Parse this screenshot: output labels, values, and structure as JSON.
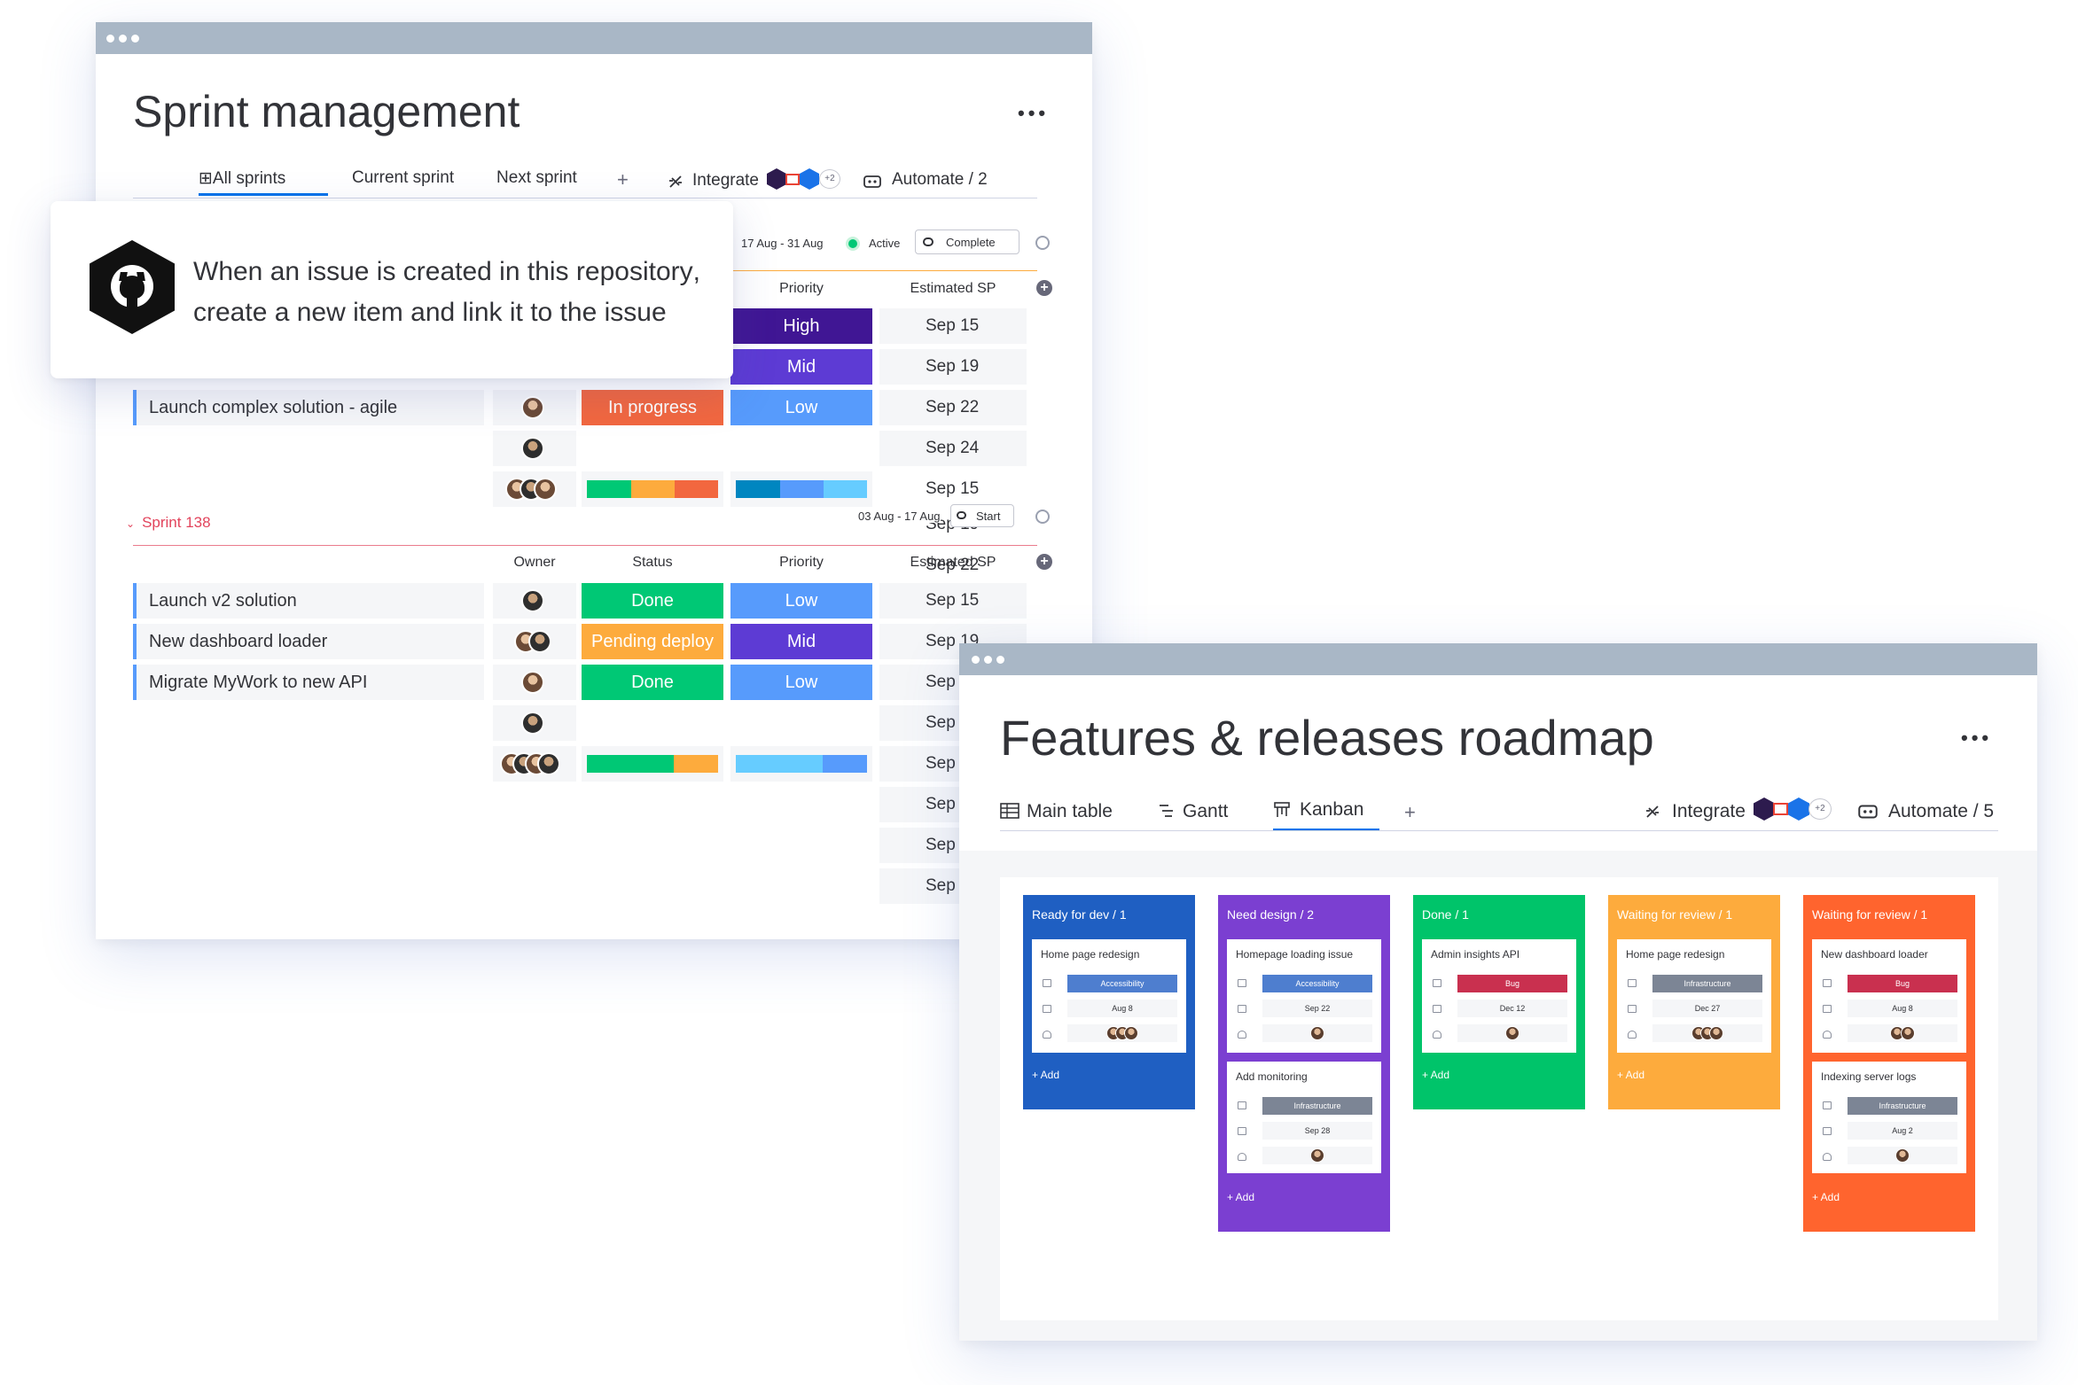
{
  "sprint": {
    "title": "Sprint management",
    "more": "•••",
    "tabs": [
      "⊞All sprints",
      "Current sprint",
      "Next sprint"
    ],
    "tab_plus": "+",
    "integrate_label": "Integrate",
    "integrate_badge": "+2",
    "automate_label": "Automate / 2",
    "group1": {
      "date_range": "17 Aug - 31 Aug",
      "state": "Active",
      "action": "Complete",
      "columns": {
        "priority": "Priority",
        "sp": "Estimated SP"
      },
      "priorities": [
        "High",
        "Mid",
        "Low"
      ],
      "row_name": "Launch complex solution - agile",
      "row_status": "In progress",
      "sp_values": [
        "Sep 15",
        "Sep 19",
        "Sep 22",
        "Sep 24",
        "Sep 15",
        "Sep 19",
        "Sep 22"
      ]
    },
    "group2": {
      "name": "Sprint 138",
      "date_range": "03 Aug - 17 Aug",
      "action": "Start",
      "columns": {
        "owner": "Owner",
        "status": "Status",
        "priority": "Priority",
        "sp": "Estimated SP"
      },
      "rows": [
        {
          "name": "Launch v2 solution",
          "status": "Done",
          "priority": "Low",
          "sp": "Sep 15"
        },
        {
          "name": "New dashboard loader",
          "status": "Pending deploy",
          "priority": "Mid",
          "sp": "Sep 19"
        },
        {
          "name": "Migrate MyWork to new API",
          "status": "Done",
          "priority": "Low",
          "sp": "Sep 1"
        }
      ],
      "sp_extra": [
        "Sep 2",
        "Sep",
        "Sep",
        "Sep",
        "Sep"
      ]
    }
  },
  "tooltip": {
    "pre": "When an issue is created in ",
    "bold1": "this repository",
    "mid": ",",
    "line2_pre": "create a new ",
    "bold2": "item",
    "line2_post": " and link it to the issue"
  },
  "roadmap": {
    "title": "Features & releases roadmap",
    "more": "•••",
    "tabs": [
      "Main table",
      "Gantt",
      "Kanban"
    ],
    "tab_plus": "+",
    "integrate_label": "Integrate",
    "integrate_badge": "+2",
    "automate_label": "Automate / 5",
    "columns": [
      {
        "title": "Ready for dev / 1",
        "color": "#1f5fc2",
        "add": "+ Add",
        "cards": [
          {
            "title": "Home page redesign",
            "tag": "Accessibility",
            "tag_color": "#4e7ecf",
            "date": "Aug 8"
          }
        ]
      },
      {
        "title": "Need design / 2",
        "color": "#7b3fd1",
        "add": "+ Add",
        "cards": [
          {
            "title": "Homepage loading issue",
            "tag": "Accessibility",
            "tag_color": "#4e7ecf",
            "date": "Sep 22"
          },
          {
            "title": "Add monitoring",
            "tag": "Infrastructure",
            "tag_color": "#7c8595",
            "date": "Sep 28"
          }
        ]
      },
      {
        "title": "Done / 1",
        "color": "#00c46a",
        "add": "+ Add",
        "cards": [
          {
            "title": "Admin insights API",
            "tag": "Bug",
            "tag_color": "#c9304f",
            "date": "Dec 12"
          }
        ]
      },
      {
        "title": "Waiting for review / 1",
        "color": "#fdab3d",
        "add": "+ Add",
        "cards": [
          {
            "title": "Home page redesign",
            "tag": "Infrastructure",
            "tag_color": "#7c8595",
            "date": "Dec 27"
          }
        ]
      },
      {
        "title": "Waiting for review / 1",
        "color": "#ff642e",
        "add": "+ Add",
        "cards": [
          {
            "title": "New dashboard loader",
            "tag": "Bug",
            "tag_color": "#c9304f",
            "date": "Aug 8"
          },
          {
            "title": "Indexing server logs",
            "tag": "Infrastructure",
            "tag_color": "#7c8595",
            "date": "Aug 2"
          }
        ]
      }
    ]
  },
  "colors": {
    "high": "#401694",
    "mid": "#5d3bd4",
    "low": "#579bfc",
    "done": "#00c875",
    "pending": "#fdab3d",
    "in_progress": "#f2673f",
    "accent": "#0073ea",
    "sprint_red": "#e2445c"
  }
}
